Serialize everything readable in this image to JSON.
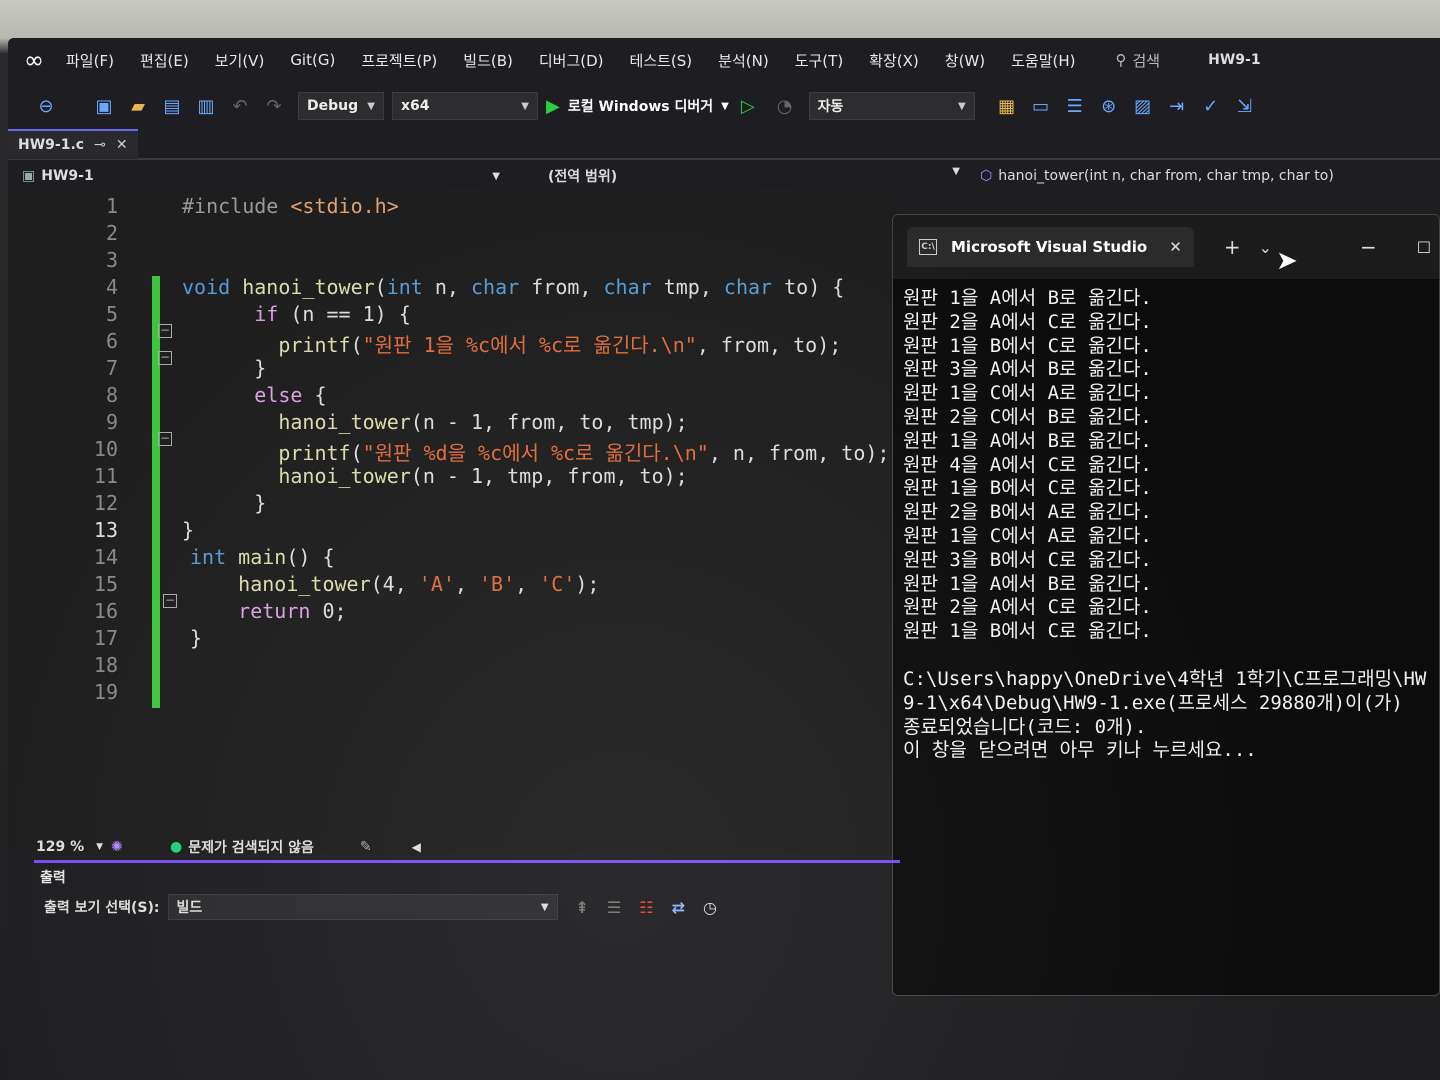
{
  "menubar": {
    "items": [
      "파일(F)",
      "편집(E)",
      "보기(V)",
      "Git(G)",
      "프로젝트(P)",
      "빌드(B)",
      "디버그(D)",
      "테스트(S)",
      "분석(N)",
      "도구(T)",
      "확장(X)",
      "창(W)",
      "도움말(H)"
    ],
    "search_label": "검색",
    "solution_title": "HW9-1"
  },
  "toolbar": {
    "config": "Debug",
    "platform": "x64",
    "run_label": "로컬 Windows 디버거",
    "auto_combo": "자동"
  },
  "tab": {
    "filename": "HW9-1.c"
  },
  "navbar": {
    "project": "HW9-1",
    "scope": "(전역 범위)",
    "function": "hanoi_tower(int n, char from, char tmp, char to)"
  },
  "editor": {
    "line_numbers": [
      "1",
      "2",
      "3",
      "4",
      "5",
      "6",
      "7",
      "8",
      "9",
      "10",
      "11",
      "12",
      "13",
      "14",
      "15",
      "16",
      "17",
      "18",
      "19"
    ],
    "current_line": "13"
  },
  "console": {
    "title": "Microsoft Visual Studio",
    "lines": [
      "원판 1을 A에서 B로 옮긴다.",
      "원판 2을 A에서 C로 옮긴다.",
      "원판 1을 B에서 C로 옮긴다.",
      "원판 3을 A에서 B로 옮긴다.",
      "원판 1을 C에서 A로 옮긴다.",
      "원판 2을 C에서 B로 옮긴다.",
      "원판 1을 A에서 B로 옮긴다.",
      "원판 4을 A에서 C로 옮긴다.",
      "원판 1을 B에서 C로 옮긴다.",
      "원판 2을 B에서 A로 옮긴다.",
      "원판 1을 C에서 A로 옮긴다.",
      "원판 3을 B에서 C로 옮긴다.",
      "원판 1을 A에서 B로 옮긴다.",
      "원판 2을 A에서 C로 옮긴다.",
      "원판 1을 B에서 C로 옮긴다."
    ],
    "exit_message": "C:\\Users\\happy\\OneDrive\\4학년 1학기\\C프로그래밍\\HW9-1\\x64\\Debug\\HW9-1.exe(프로세스 29880개)이(가) 종료되었습니다(코드: 0개).",
    "press_key": "이 창을 닫으려면 아무 키나 누르세요..."
  },
  "status": {
    "zoom": "129 %",
    "issues": "문제가 검색되지 않음"
  },
  "output": {
    "title": "출력",
    "source_label": "출력 보기 선택(S):",
    "source_value": "빌드"
  },
  "colors": {
    "accent": "#7a4df0",
    "change_bar": "#3ec43e",
    "keyword": "#569cd6",
    "string": "#e06c3c"
  }
}
